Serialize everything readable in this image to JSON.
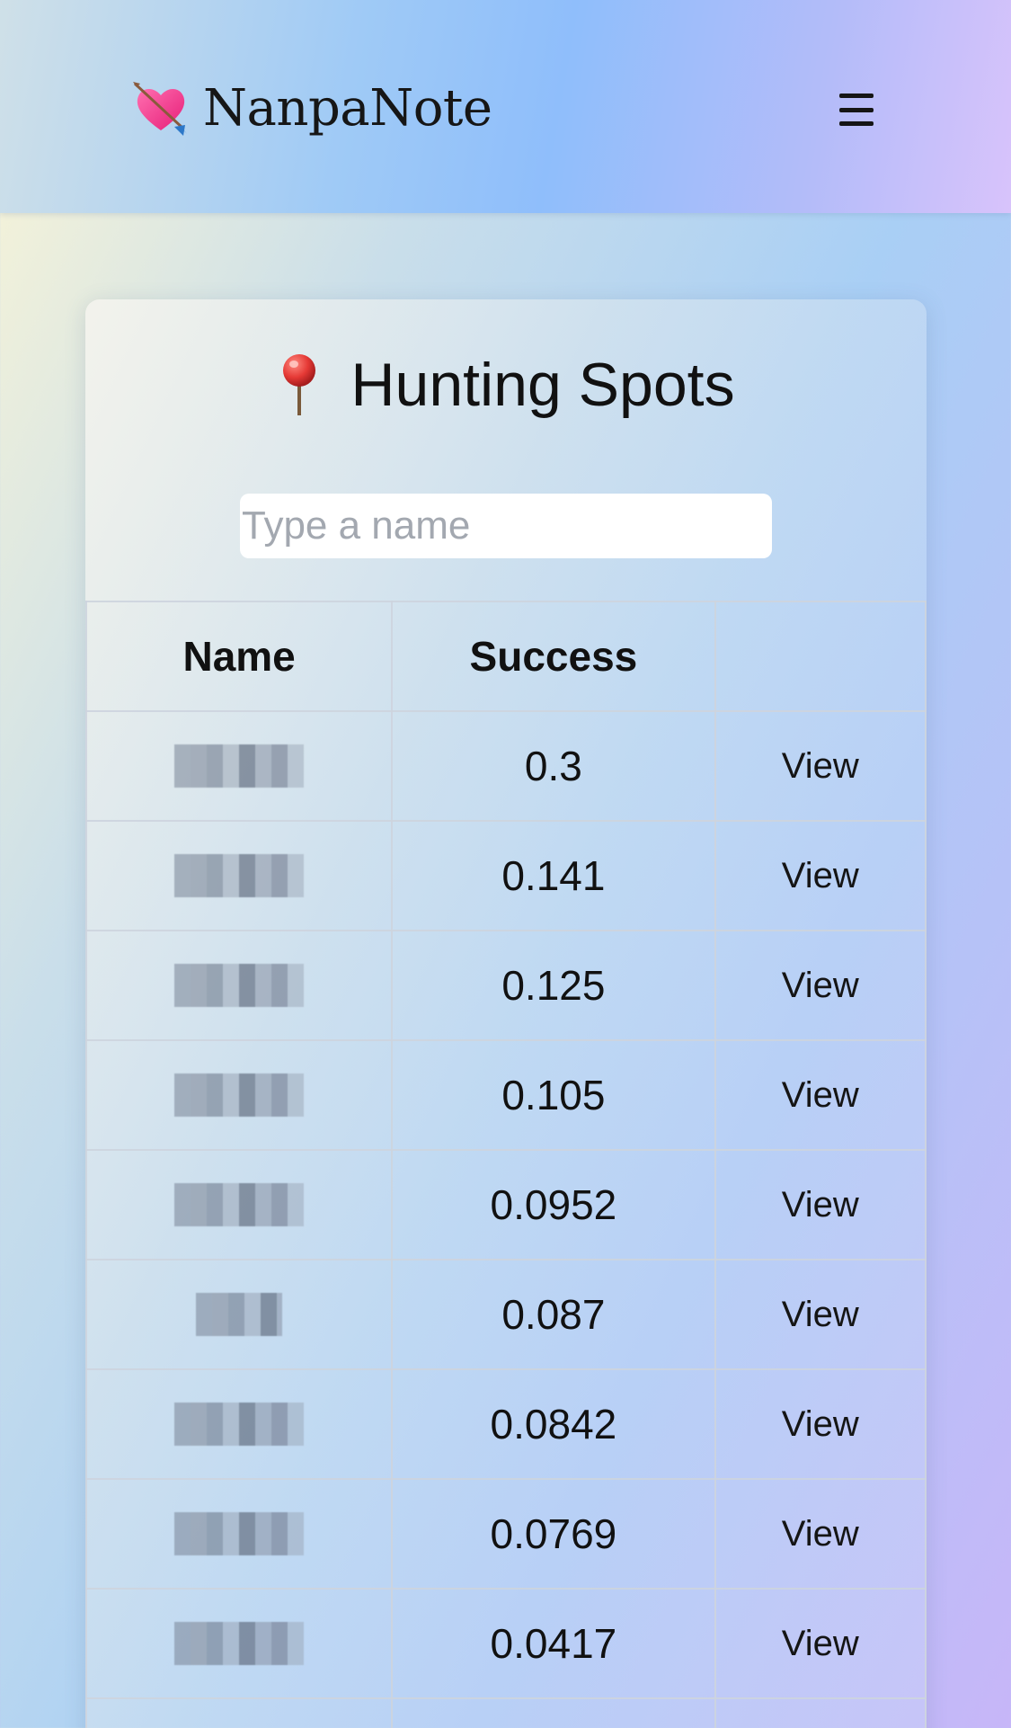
{
  "header": {
    "brand_name": "NanpaNote",
    "brand_icon": "heart-with-arrow-icon",
    "menu_icon": "hamburger-menu-icon"
  },
  "page": {
    "title": "Hunting Spots",
    "title_icon": "round-pushpin-icon",
    "search": {
      "placeholder": "Type a name",
      "value": ""
    }
  },
  "table": {
    "columns": [
      "Name",
      "Success",
      ""
    ],
    "rows": [
      {
        "name": "",
        "success": "0.3",
        "action": "View"
      },
      {
        "name": "",
        "success": "0.141",
        "action": "View"
      },
      {
        "name": "",
        "success": "0.125",
        "action": "View"
      },
      {
        "name": "",
        "success": "0.105",
        "action": "View"
      },
      {
        "name": "",
        "success": "0.0952",
        "action": "View"
      },
      {
        "name": "",
        "success": "0.087",
        "action": "View"
      },
      {
        "name": "",
        "success": "0.0842",
        "action": "View"
      },
      {
        "name": "",
        "success": "0.0769",
        "action": "View"
      },
      {
        "name": "",
        "success": "0.0417",
        "action": "View"
      }
    ]
  }
}
